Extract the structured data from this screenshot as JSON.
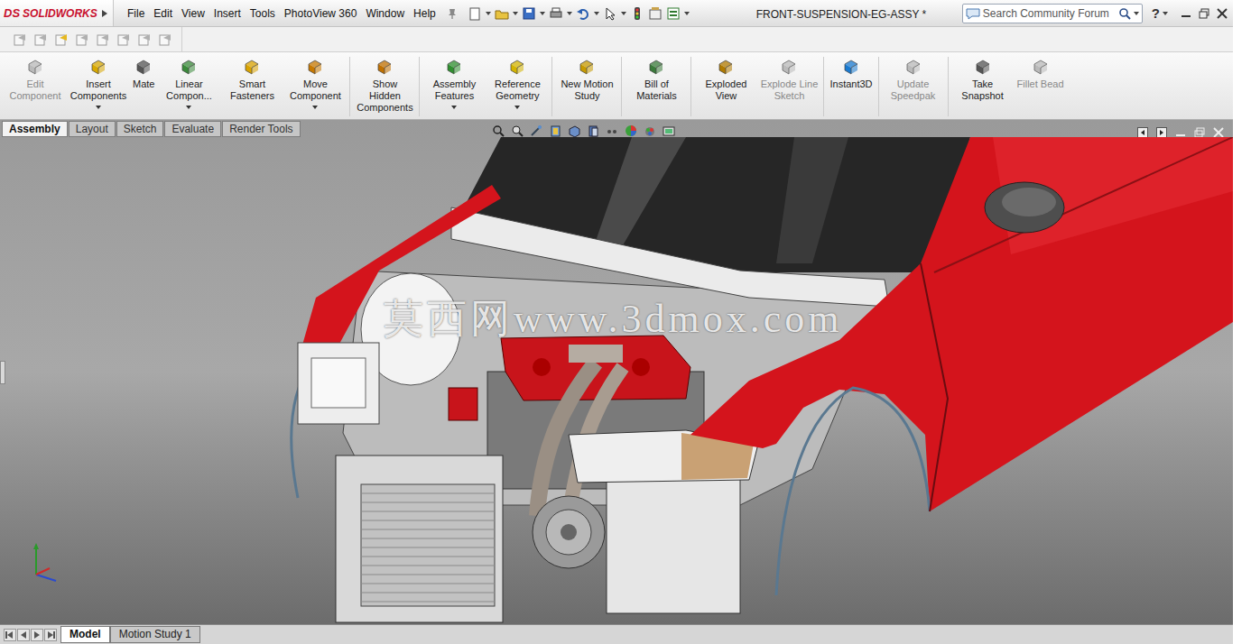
{
  "window": {
    "title": "FRONT-SUSPENSION-EG-ASSY *"
  },
  "logo": {
    "mark": "DS",
    "name": "SOLIDWORKS"
  },
  "menu": [
    "File",
    "Edit",
    "View",
    "Insert",
    "Tools",
    "PhotoView 360",
    "Window",
    "Help"
  ],
  "search": {
    "placeholder": "Search Community Forum"
  },
  "help": "?",
  "command_groups": [
    [
      {
        "label": "Edit Component",
        "disabled": true,
        "dropdown": false
      },
      {
        "label": "Insert Components",
        "disabled": false,
        "dropdown": true
      },
      {
        "label": "Mate",
        "disabled": false,
        "dropdown": false
      },
      {
        "label": "Linear Compon...",
        "disabled": false,
        "dropdown": true
      },
      {
        "label": "Smart Fasteners",
        "disabled": false,
        "dropdown": false
      },
      {
        "label": "Move Component",
        "disabled": false,
        "dropdown": true
      }
    ],
    [
      {
        "label": "Show Hidden Components",
        "disabled": false,
        "dropdown": false
      }
    ],
    [
      {
        "label": "Assembly Features",
        "disabled": false,
        "dropdown": true
      },
      {
        "label": "Reference Geometry",
        "disabled": false,
        "dropdown": true
      }
    ],
    [
      {
        "label": "New Motion Study",
        "disabled": false,
        "dropdown": false
      }
    ],
    [
      {
        "label": "Bill of Materials",
        "disabled": false,
        "dropdown": false
      }
    ],
    [
      {
        "label": "Exploded View",
        "disabled": false,
        "dropdown": false
      },
      {
        "label": "Explode Line Sketch",
        "disabled": true,
        "dropdown": false
      }
    ],
    [
      {
        "label": "Instant3D",
        "disabled": false,
        "dropdown": false
      }
    ],
    [
      {
        "label": "Update Speedpak",
        "disabled": true,
        "dropdown": false
      }
    ],
    [
      {
        "label": "Take Snapshot",
        "disabled": false,
        "dropdown": false
      },
      {
        "label": "Fillet Bead",
        "disabled": true,
        "dropdown": false
      }
    ]
  ],
  "tabs": [
    {
      "label": "Assembly",
      "selected": true
    },
    {
      "label": "Layout",
      "selected": false
    },
    {
      "label": "Sketch",
      "selected": false
    },
    {
      "label": "Evaluate",
      "selected": false
    },
    {
      "label": "Render Tools",
      "selected": false
    }
  ],
  "bottom_tabs": [
    {
      "label": "Model",
      "selected": true
    },
    {
      "label": "Motion Study 1",
      "selected": false
    }
  ],
  "watermark": "莫西网www.3dmox.com"
}
